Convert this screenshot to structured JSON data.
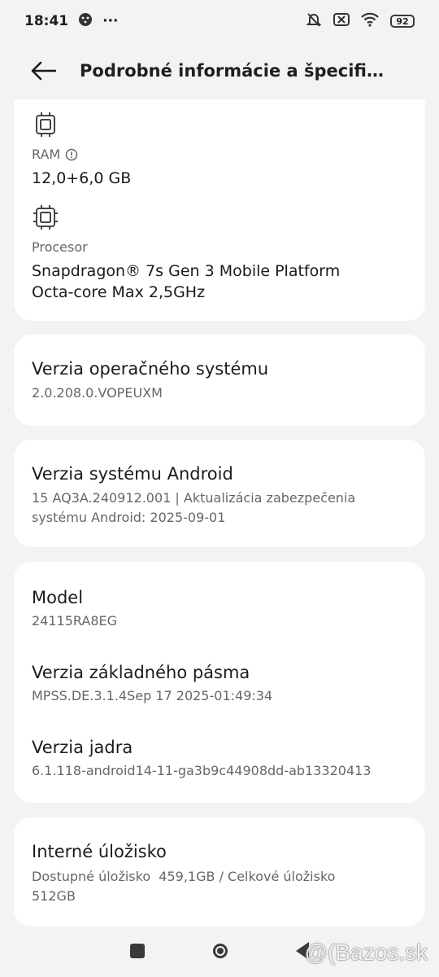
{
  "status_bar": {
    "time": "18:41",
    "more": "···",
    "battery": "92"
  },
  "header": {
    "title": "Podrobné informácie a špecifik…"
  },
  "specs": {
    "ram_label": "RAM",
    "ram_value": "12,0+6,0 GB",
    "cpu_label": "Procesor",
    "cpu_line1": "Snapdragon® 7s Gen 3 Mobile Platform",
    "cpu_line2": "Octa-core Max 2,5GHz"
  },
  "os_version": {
    "title": "Verzia operačného systému",
    "value": "2.0.208.0.VOPEUXM"
  },
  "android_version": {
    "title": "Verzia systému Android",
    "line1": "15 AQ3A.240912.001 | Aktualizácia zabezpečenia",
    "line2": "systému Android: 2025-09-01"
  },
  "device": {
    "model_title": "Model",
    "model_value": "24115RA8EG",
    "baseband_title": "Verzia základného pásma",
    "baseband_value": "MPSS.DE.3.1.4Sep 17 2025-01:49:34",
    "kernel_title": "Verzia jadra",
    "kernel_value": "6.1.118-android14-11-ga3b9c44908dd-ab13320413"
  },
  "storage": {
    "title": "Interné úložisko",
    "line1": "Dostupné úložisko  459,1GB / Celkové úložisko",
    "line2": "512GB"
  },
  "watermark": "@(Bazos.sk"
}
